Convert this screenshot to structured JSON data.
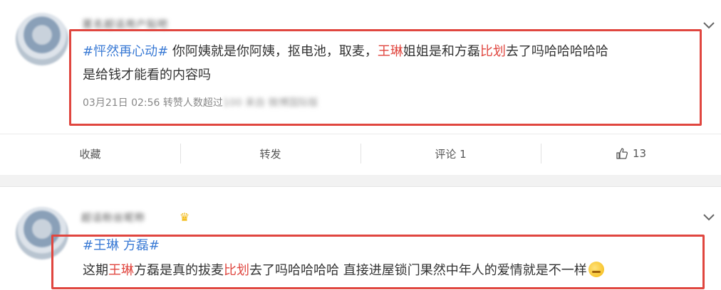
{
  "post1": {
    "username": "匿名超话用户贴吧",
    "topic": "#怦然再心动#",
    "text_a": " 你阿姨就是你阿姨，抠电池，取麦，",
    "name_hl": "王琳",
    "text_b": "姐姐是和方磊",
    "word_hl": "比划",
    "text_c": "去了吗哈哈哈哈哈",
    "line2": "是给钱才能看的内容吗",
    "meta_time": "03月21日 02:56",
    "meta_repost": "转赞人数超过",
    "meta_blurred": "100  来自 微博国际版",
    "actions": {
      "favorite": "收藏",
      "repost": "转发",
      "comment": "评论 1",
      "like_count": "13"
    }
  },
  "post2": {
    "username": "超话粉丝昵称",
    "topic_name": "#王琳",
    "topic_name2": " 方磊#",
    "text_a": "这期",
    "name_hl": "王琳",
    "text_b": "方磊是真的拔麦",
    "word_hl": "比划",
    "text_c": "去了吗哈哈哈哈 直接进屋锁门果然中年人的爱情就是不一样"
  },
  "colors": {
    "topic": "#3b7bd5",
    "highlight": "#e0463f",
    "redbox": "#e0463f"
  }
}
